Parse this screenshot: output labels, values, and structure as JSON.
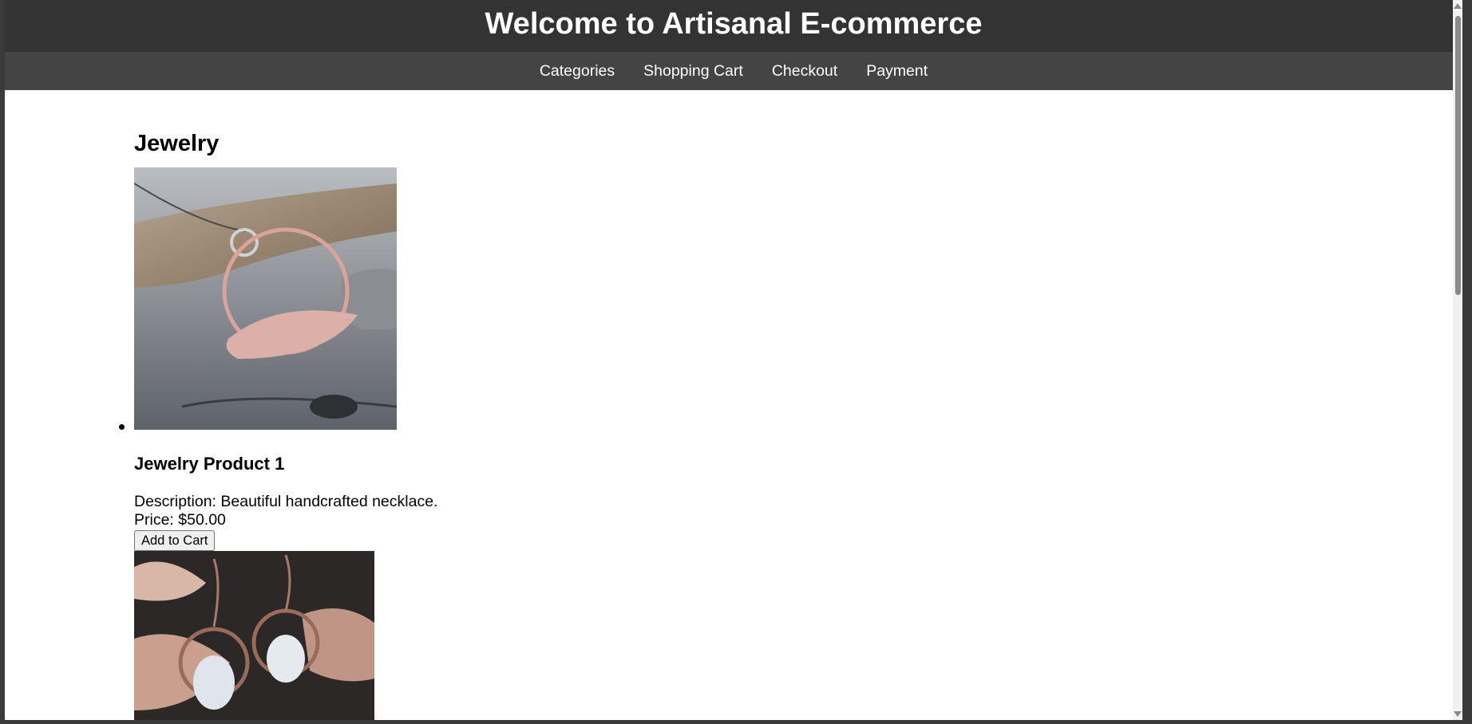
{
  "header": {
    "title": "Welcome to Artisanal E-commerce"
  },
  "nav": {
    "items": [
      {
        "label": "Categories"
      },
      {
        "label": "Shopping Cart"
      },
      {
        "label": "Checkout"
      },
      {
        "label": "Payment"
      }
    ]
  },
  "category": {
    "title": "Jewelry"
  },
  "products": [
    {
      "image_icon": "necklace-photo",
      "name": "Jewelry Product 1",
      "description": "Description: Beautiful handcrafted necklace.",
      "price": "Price: $50.00",
      "button_label": "Add to Cart"
    },
    {
      "image_icon": "earrings-photo"
    }
  ],
  "colors": {
    "header_bg": "#333333",
    "nav_bg": "#444444",
    "header_text": "#ffffff"
  }
}
